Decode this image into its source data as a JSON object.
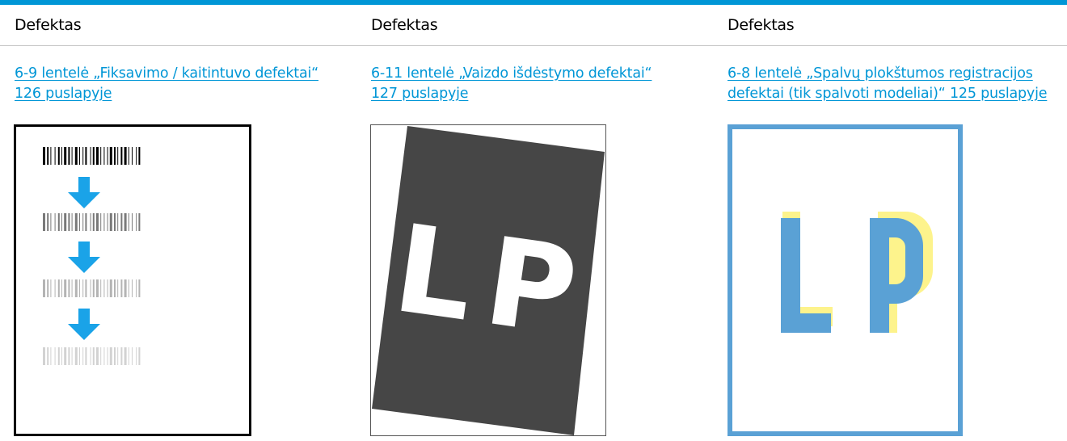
{
  "table": {
    "columns": [
      {
        "header": "Defektas",
        "link_line1": "6-9 lentelė „Fiksavimo / kaitintuvo defektai“",
        "link_line2": "126 puslapyje",
        "figure": "barcode-fade-icon"
      },
      {
        "header": "Defektas",
        "link_line1": "6-11 lentelė „Vaizdo išdėstymo defektai“",
        "link_line2": "127 puslapyje",
        "figure": "skewed-page-icon"
      },
      {
        "header": "Defektas",
        "link_line1": "6-8 lentelė „Spalvų plokštumos registracijos",
        "link_line2": "defektai (tik spalvoti modeliai)“ 125 puslapyje",
        "figure": "color-misregistration-icon"
      }
    ],
    "figure_text": {
      "letters": "LP"
    }
  },
  "colors": {
    "accent": "#0096d6",
    "arrow": "#1aa3e8",
    "dark_fill": "#464646",
    "blue_letter": "#5aa1d5",
    "yellow_shadow": "#fdf38c",
    "frame_blue": "#5aa1d5"
  }
}
